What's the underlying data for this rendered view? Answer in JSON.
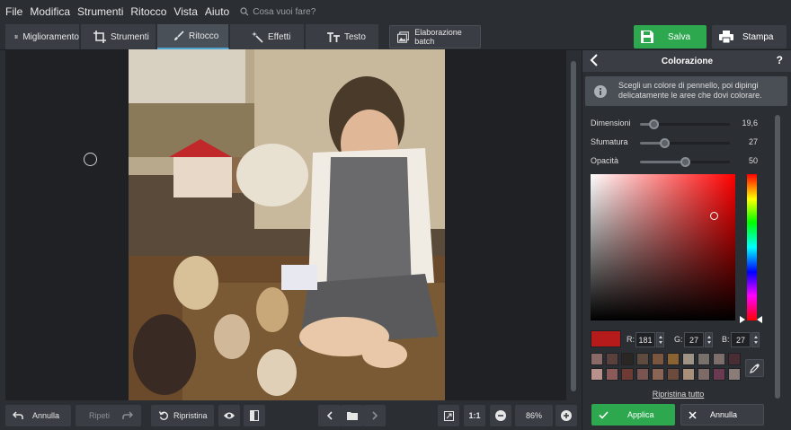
{
  "menu": {
    "items": [
      "File",
      "Modifica",
      "Strumenti",
      "Ritocco",
      "Vista",
      "Aiuto"
    ],
    "search_placeholder": "Cosa vuoi fare?"
  },
  "toolbar": {
    "tabs": [
      {
        "label": "Miglioramento",
        "icon": "sliders-icon"
      },
      {
        "label": "Strumenti",
        "icon": "crop-icon"
      },
      {
        "label": "Ritocco",
        "icon": "brush-icon",
        "active": true
      },
      {
        "label": "Effetti",
        "icon": "magic-wand-icon"
      },
      {
        "label": "Testo",
        "icon": "text-icon"
      }
    ],
    "batch_label": "Elaborazione batch",
    "save_label": "Salva",
    "print_label": "Stampa"
  },
  "bottom": {
    "undo_label": "Annulla",
    "redo_label": "Ripeti",
    "reset_label": "Ripristina",
    "ratio_label": "1:1",
    "zoom_value": "86%"
  },
  "panel": {
    "title": "Colorazione",
    "help": "?",
    "info_text": "Scegli un colore di pennello, poi dipingi delicatamente le aree che dovi colorare.",
    "sliders": [
      {
        "label": "Dimensioni",
        "value": "19,6",
        "fraction": 0.15
      },
      {
        "label": "Sfumatura",
        "value": "27",
        "fraction": 0.27
      },
      {
        "label": "Opacità",
        "value": "50",
        "fraction": 0.5
      }
    ],
    "rgb": {
      "r_label": "R:",
      "r": "181",
      "g_label": "G:",
      "g": "27",
      "b_label": "B:",
      "b": "27"
    },
    "current_color": "#b51b1b",
    "palette": [
      "#8a6a66",
      "#5a403d",
      "#2a2624",
      "#5e4a3e",
      "#7a5540",
      "#8a6330",
      "#9e9486",
      "#78706a",
      "#7c6e6a",
      "#4a2c34",
      "#b8908c",
      "#8c5a58",
      "#6e3a34",
      "#7a5450",
      "#8a6454",
      "#6c4a3c",
      "#a8907a",
      "#7e6a66",
      "#6a3a50",
      "#8a7c76"
    ],
    "reset_all_label": "Ripristina tutto",
    "apply_label": "Applica",
    "cancel_label": "Annulla"
  }
}
